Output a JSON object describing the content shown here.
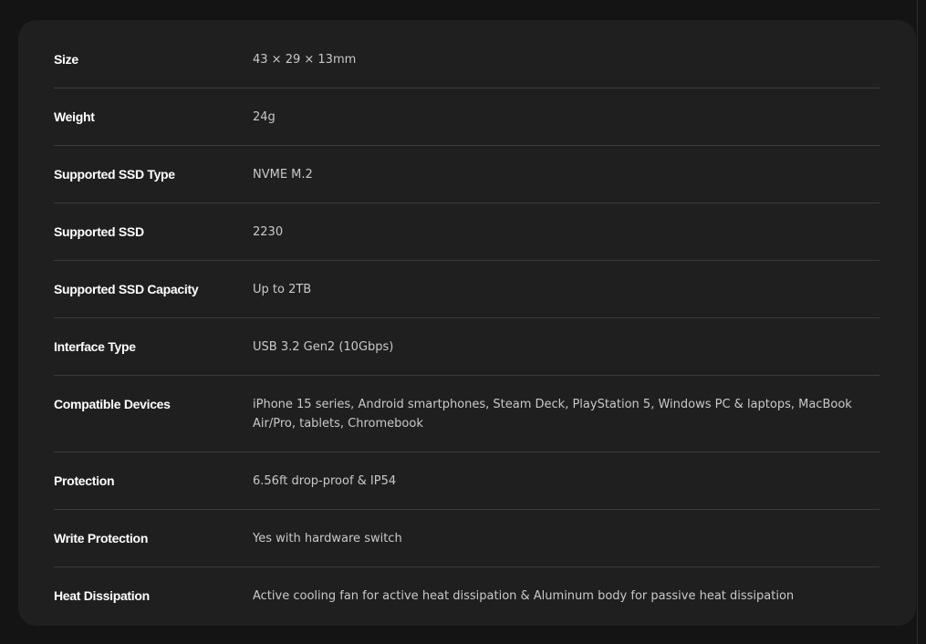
{
  "specs": [
    {
      "label": "Size",
      "value": "43 × 29 × 13mm"
    },
    {
      "label": "Weight",
      "value": "24g"
    },
    {
      "label": "Supported SSD Type",
      "value": "NVME M.2"
    },
    {
      "label": "Supported SSD",
      "value": "2230"
    },
    {
      "label": "Supported SSD Capacity",
      "value": "Up to 2TB"
    },
    {
      "label": "Interface Type",
      "value": "USB 3.2 Gen2 (10Gbps)"
    },
    {
      "label": "Compatible Devices",
      "value": "iPhone 15 series, Android smartphones, Steam Deck, PlayStation 5, Windows PC & laptops, MacBook Air/Pro, tablets, Chromebook"
    },
    {
      "label": "Protection",
      "value": "6.56ft drop-proof & IP54"
    },
    {
      "label": "Write Protection",
      "value": "Yes with hardware switch"
    },
    {
      "label": "Heat Dissipation",
      "value": "Active cooling fan for active heat dissipation & Aluminum body for passive heat dissipation"
    }
  ]
}
